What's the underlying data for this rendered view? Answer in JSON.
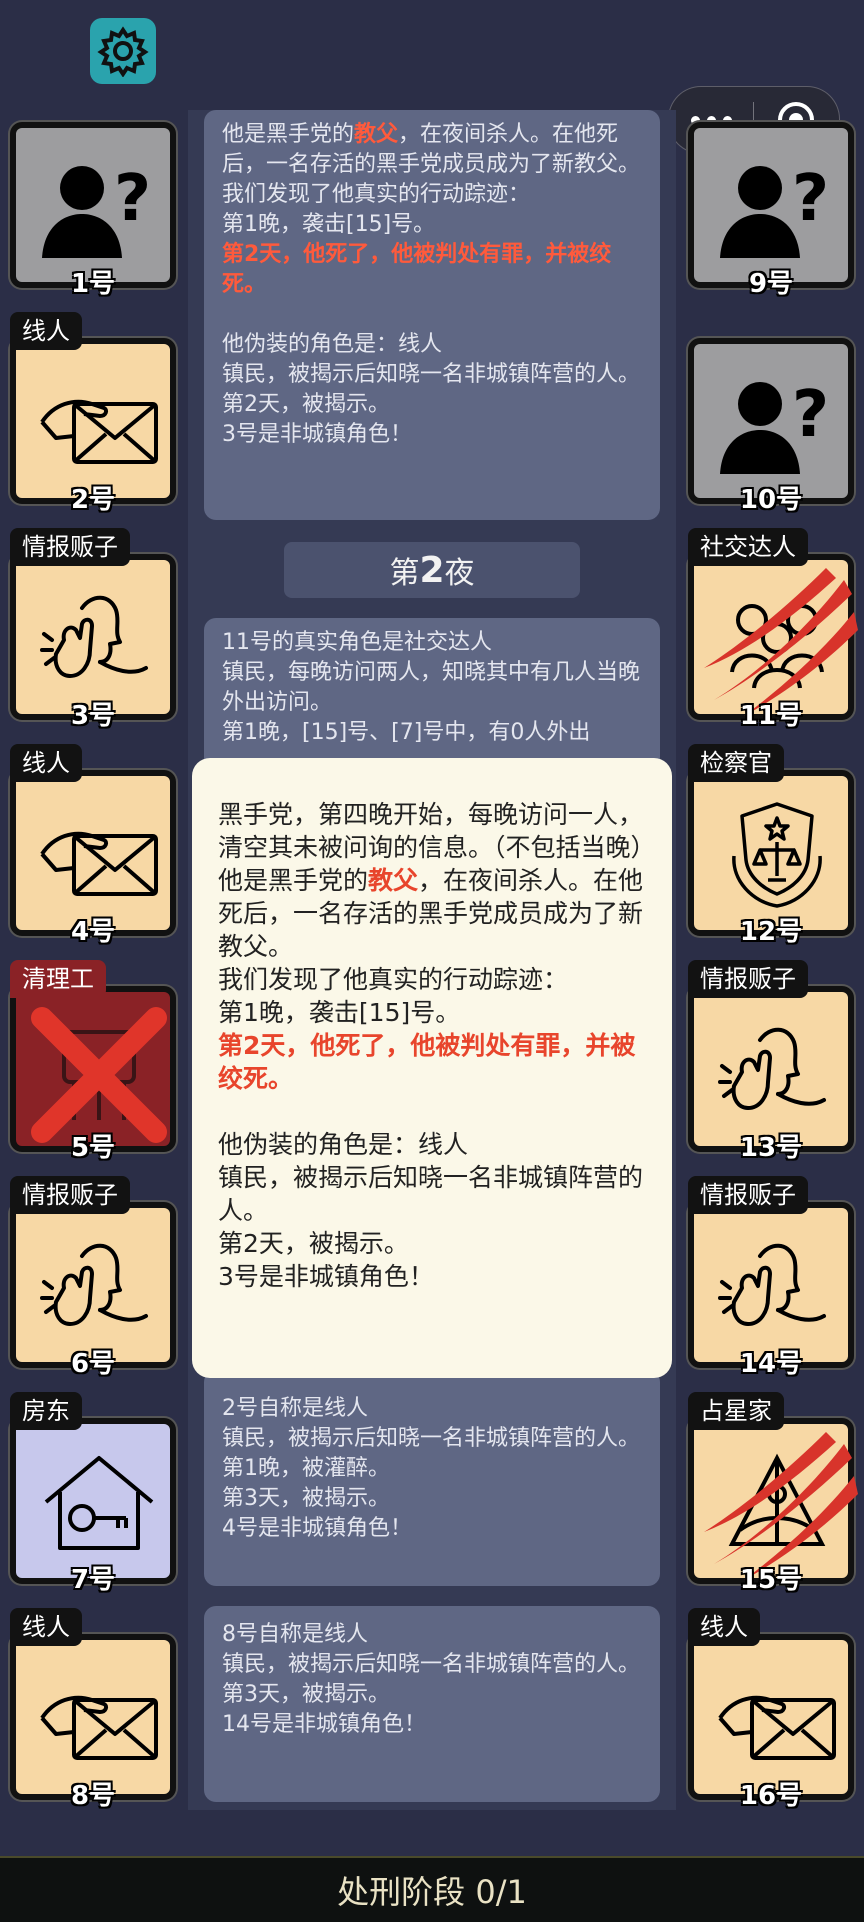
{
  "log": {
    "entry1": {
      "intro_a": "他是黑手党的",
      "intro_role": "教父",
      "intro_b": "，在夜间杀人。在他死后，一名存活的黑手党成员成为了新教父。",
      "trace": "我们发现了他真实的行动踪迹：",
      "night1": "第1晚，袭击[15]号。",
      "death": "第2天，他死了，他被判处有罪，并被绞死。",
      "disguise": "他伪装的角色是：线人",
      "disguise_desc": "镇民，被揭示后知晓一名非城镇阵营的人。",
      "revealed": "第2天，被揭示。",
      "result": "3号是非城镇角色！"
    },
    "night_header": {
      "prefix": "第",
      "num": "2",
      "suffix": "夜"
    },
    "entry2": {
      "line1": "11号的真实角色是社交达人",
      "line2": "镇民，每晚访问两人，知晓其中有几人当晚外出访问。",
      "line3": "第1晚，[15]号、[7]号中，有0人外出"
    },
    "entry3": {
      "line1": "2号自称是线人",
      "line2": "镇民，被揭示后知晓一名非城镇阵营的人。",
      "line3": "第1晚，被灌醉。",
      "line4": "第3天，被揭示。",
      "line5": "4号是非城镇角色！"
    },
    "entry4": {
      "line1": "8号自称是线人",
      "line2": "镇民，被揭示后知晓一名非城镇阵营的人。",
      "line3": "第3天，被揭示。",
      "line4": "14号是非城镇角色！"
    }
  },
  "popup": {
    "line1": "黑手党，第四晚开始，每晚访问一人，清空其未被问询的信息。（不包括当晚）",
    "intro_a": "他是黑手党的",
    "intro_role": "教父",
    "intro_b": "，在夜间杀人。在他死后，一名存活的黑手党成员成为了新教父。",
    "trace": "我们发现了他真实的行动踪迹：",
    "night1": "第1晚，袭击[15]号。",
    "death": "第2天，他死了，他被判处有罪，并被绞死。",
    "disguise": "他伪装的角色是：线人",
    "disguise_desc": "镇民，被揭示后知晓一名非城镇阵营的人。",
    "revealed": "第2天，被揭示。",
    "result": "3号是非城镇角色！"
  },
  "players_left": [
    {
      "num": "1号",
      "tag": "",
      "icon": "unknown-player-icon",
      "state": "unknown"
    },
    {
      "num": "2号",
      "tag": "线人",
      "icon": "envelope-hand-icon",
      "state": "normal"
    },
    {
      "num": "3号",
      "tag": "情报贩子",
      "icon": "whisper-icon",
      "state": "normal"
    },
    {
      "num": "4号",
      "tag": "线人",
      "icon": "envelope-hand-icon",
      "state": "normal"
    },
    {
      "num": "5号",
      "tag": "清理工",
      "icon": "cleaner-icon",
      "state": "dead"
    },
    {
      "num": "6号",
      "tag": "情报贩子",
      "icon": "whisper-icon",
      "state": "normal"
    },
    {
      "num": "7号",
      "tag": "房东",
      "icon": "house-key-icon",
      "state": "house"
    },
    {
      "num": "8号",
      "tag": "线人",
      "icon": "envelope-hand-icon",
      "state": "normal"
    }
  ],
  "players_right": [
    {
      "num": "9号",
      "tag": "",
      "icon": "unknown-player-icon",
      "state": "unknown"
    },
    {
      "num": "10号",
      "tag": "",
      "icon": "unknown-player-icon",
      "state": "unknown"
    },
    {
      "num": "11号",
      "tag": "社交达人",
      "icon": "socialite-icon",
      "state": "clawed"
    },
    {
      "num": "12号",
      "tag": "检察官",
      "icon": "prosecutor-badge-icon",
      "state": "normal"
    },
    {
      "num": "13号",
      "tag": "情报贩子",
      "icon": "whisper-icon",
      "state": "normal"
    },
    {
      "num": "14号",
      "tag": "情报贩子",
      "icon": "whisper-icon",
      "state": "normal"
    },
    {
      "num": "15号",
      "tag": "占星家",
      "icon": "sextant-icon",
      "state": "clawed"
    },
    {
      "num": "16号",
      "tag": "线人",
      "icon": "envelope-hand-icon",
      "state": "normal"
    }
  ],
  "bottom": {
    "phase": "处刑阶段 0/1"
  },
  "colors": {
    "background": "#2b2e47",
    "card": "#f7d8a5",
    "highlight_red": "#e8452c",
    "settings": "#2aa3ad"
  }
}
